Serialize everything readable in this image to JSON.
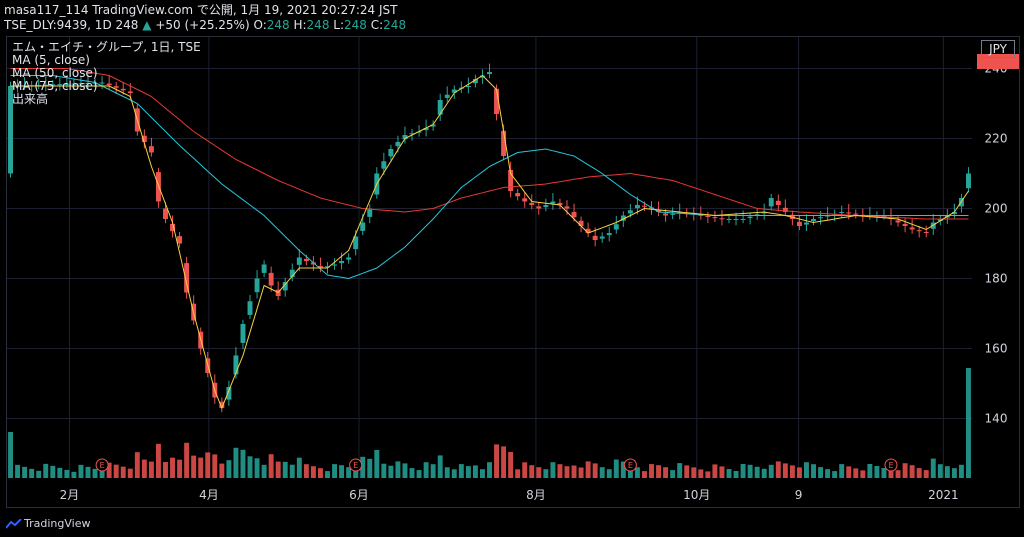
{
  "header": {
    "publish_line": "masa117_114 TradingView.com で公開, 1月 19, 2021 20:27:24 JST",
    "symbol": "TSE_DLY:9439, 1D",
    "last": "248",
    "change_arrow": "▲",
    "change": "+50 (+25.25%)",
    "o_label": "O:",
    "o_value": "248",
    "h_label": "H:",
    "h_value": "248",
    "l_label": "L:",
    "l_value": "248",
    "c_label": "C:",
    "c_value": "248"
  },
  "legend": {
    "title": "エム・エイチ・グループ, 1日, TSE",
    "ma5": "MA (5, close)",
    "ma50": "MA (50, close)",
    "ma75": "MA (75, close)",
    "volume": "出来高"
  },
  "currency": "JPY",
  "footer": {
    "brand": "TradingView"
  },
  "colors": {
    "up": "#26a69a",
    "down": "#ef5350",
    "ma5": "#f5d142",
    "ma50": "#26c6da",
    "ma75": "#e53935",
    "grid": "#1c2030"
  },
  "chart_data": {
    "type": "candlestick",
    "ylim": [
      123,
      249
    ],
    "y_ticks": [
      140,
      160,
      180,
      200,
      220,
      240
    ],
    "x_ticks": [
      "2月",
      "4月",
      "6月",
      "8月",
      "10月",
      "9",
      "2021"
    ],
    "event_marker": "E",
    "price_path": [
      [
        0,
        235
      ],
      [
        13,
        236
      ],
      [
        17,
        233
      ],
      [
        18,
        222
      ],
      [
        20,
        216
      ],
      [
        21,
        202
      ],
      [
        22,
        197
      ],
      [
        24,
        190
      ],
      [
        25,
        176
      ],
      [
        27,
        160
      ],
      [
        29,
        146
      ],
      [
        30,
        143
      ],
      [
        31,
        149
      ],
      [
        33,
        167
      ],
      [
        35,
        180
      ],
      [
        36,
        184
      ],
      [
        37,
        178
      ],
      [
        38,
        175
      ],
      [
        39,
        179
      ],
      [
        41,
        186
      ],
      [
        43,
        184
      ],
      [
        44,
        183
      ],
      [
        46,
        184
      ],
      [
        48,
        186
      ],
      [
        49,
        192
      ],
      [
        51,
        200
      ],
      [
        52,
        210
      ],
      [
        54,
        217
      ],
      [
        56,
        221
      ],
      [
        58,
        222
      ],
      [
        60,
        224
      ],
      [
        61,
        231
      ],
      [
        63,
        234
      ],
      [
        65,
        235
      ],
      [
        66,
        237
      ],
      [
        67,
        238
      ],
      [
        68,
        239
      ],
      [
        69,
        227
      ],
      [
        70,
        215
      ],
      [
        71,
        205
      ],
      [
        73,
        202
      ],
      [
        75,
        200
      ],
      [
        77,
        202
      ],
      [
        79,
        200
      ],
      [
        81,
        195
      ],
      [
        83,
        191
      ],
      [
        85,
        193
      ],
      [
        87,
        198
      ],
      [
        89,
        201
      ],
      [
        91,
        200
      ],
      [
        93,
        198
      ],
      [
        95,
        199
      ],
      [
        98,
        198
      ],
      [
        101,
        197
      ],
      [
        104,
        197
      ],
      [
        107,
        199
      ],
      [
        108,
        203
      ],
      [
        110,
        199
      ],
      [
        112,
        195
      ],
      [
        114,
        197
      ],
      [
        116,
        198
      ],
      [
        118,
        199
      ],
      [
        121,
        198
      ],
      [
        124,
        198
      ],
      [
        126,
        196
      ],
      [
        128,
        194
      ],
      [
        130,
        193
      ],
      [
        131,
        196
      ],
      [
        133,
        198
      ],
      [
        134,
        199
      ],
      [
        135,
        203
      ],
      [
        136,
        210
      ]
    ],
    "ma5_path": [
      [
        0,
        235
      ],
      [
        14,
        235
      ],
      [
        17,
        232
      ],
      [
        20,
        212
      ],
      [
        23,
        196
      ],
      [
        26,
        170
      ],
      [
        29,
        148
      ],
      [
        30,
        143
      ],
      [
        33,
        158
      ],
      [
        36,
        178
      ],
      [
        38,
        176
      ],
      [
        41,
        183
      ],
      [
        45,
        183
      ],
      [
        48,
        188
      ],
      [
        52,
        207
      ],
      [
        56,
        220
      ],
      [
        60,
        224
      ],
      [
        63,
        233
      ],
      [
        67,
        238
      ],
      [
        69,
        234
      ],
      [
        71,
        210
      ],
      [
        74,
        202
      ],
      [
        78,
        201
      ],
      [
        82,
        193
      ],
      [
        86,
        196
      ],
      [
        90,
        200
      ],
      [
        100,
        198
      ],
      [
        107,
        199
      ],
      [
        110,
        198
      ],
      [
        114,
        196
      ],
      [
        120,
        198
      ],
      [
        126,
        197
      ],
      [
        130,
        194
      ],
      [
        134,
        199
      ],
      [
        136,
        205
      ]
    ],
    "ma50_path": [
      [
        0,
        238
      ],
      [
        6,
        238
      ],
      [
        12,
        236
      ],
      [
        18,
        230
      ],
      [
        24,
        218
      ],
      [
        30,
        207
      ],
      [
        36,
        198
      ],
      [
        41,
        188
      ],
      [
        45,
        181
      ],
      [
        48,
        180
      ],
      [
        52,
        183
      ],
      [
        56,
        189
      ],
      [
        60,
        197
      ],
      [
        64,
        206
      ],
      [
        68,
        212
      ],
      [
        72,
        216
      ],
      [
        76,
        217
      ],
      [
        80,
        215
      ],
      [
        84,
        210
      ],
      [
        88,
        204
      ],
      [
        92,
        199
      ],
      [
        100,
        198
      ],
      [
        110,
        198
      ],
      [
        120,
        198
      ],
      [
        130,
        198
      ],
      [
        136,
        198
      ]
    ],
    "ma75_path": [
      [
        0,
        240
      ],
      [
        8,
        240
      ],
      [
        14,
        238
      ],
      [
        20,
        232
      ],
      [
        26,
        222
      ],
      [
        32,
        214
      ],
      [
        38,
        208
      ],
      [
        44,
        203
      ],
      [
        50,
        200
      ],
      [
        56,
        199
      ],
      [
        60,
        200
      ],
      [
        64,
        203
      ],
      [
        70,
        206
      ],
      [
        76,
        207
      ],
      [
        82,
        209
      ],
      [
        88,
        210
      ],
      [
        94,
        208
      ],
      [
        100,
        204
      ],
      [
        106,
        200
      ],
      [
        112,
        199
      ],
      [
        120,
        198
      ],
      [
        130,
        197
      ],
      [
        136,
        197
      ]
    ]
  }
}
